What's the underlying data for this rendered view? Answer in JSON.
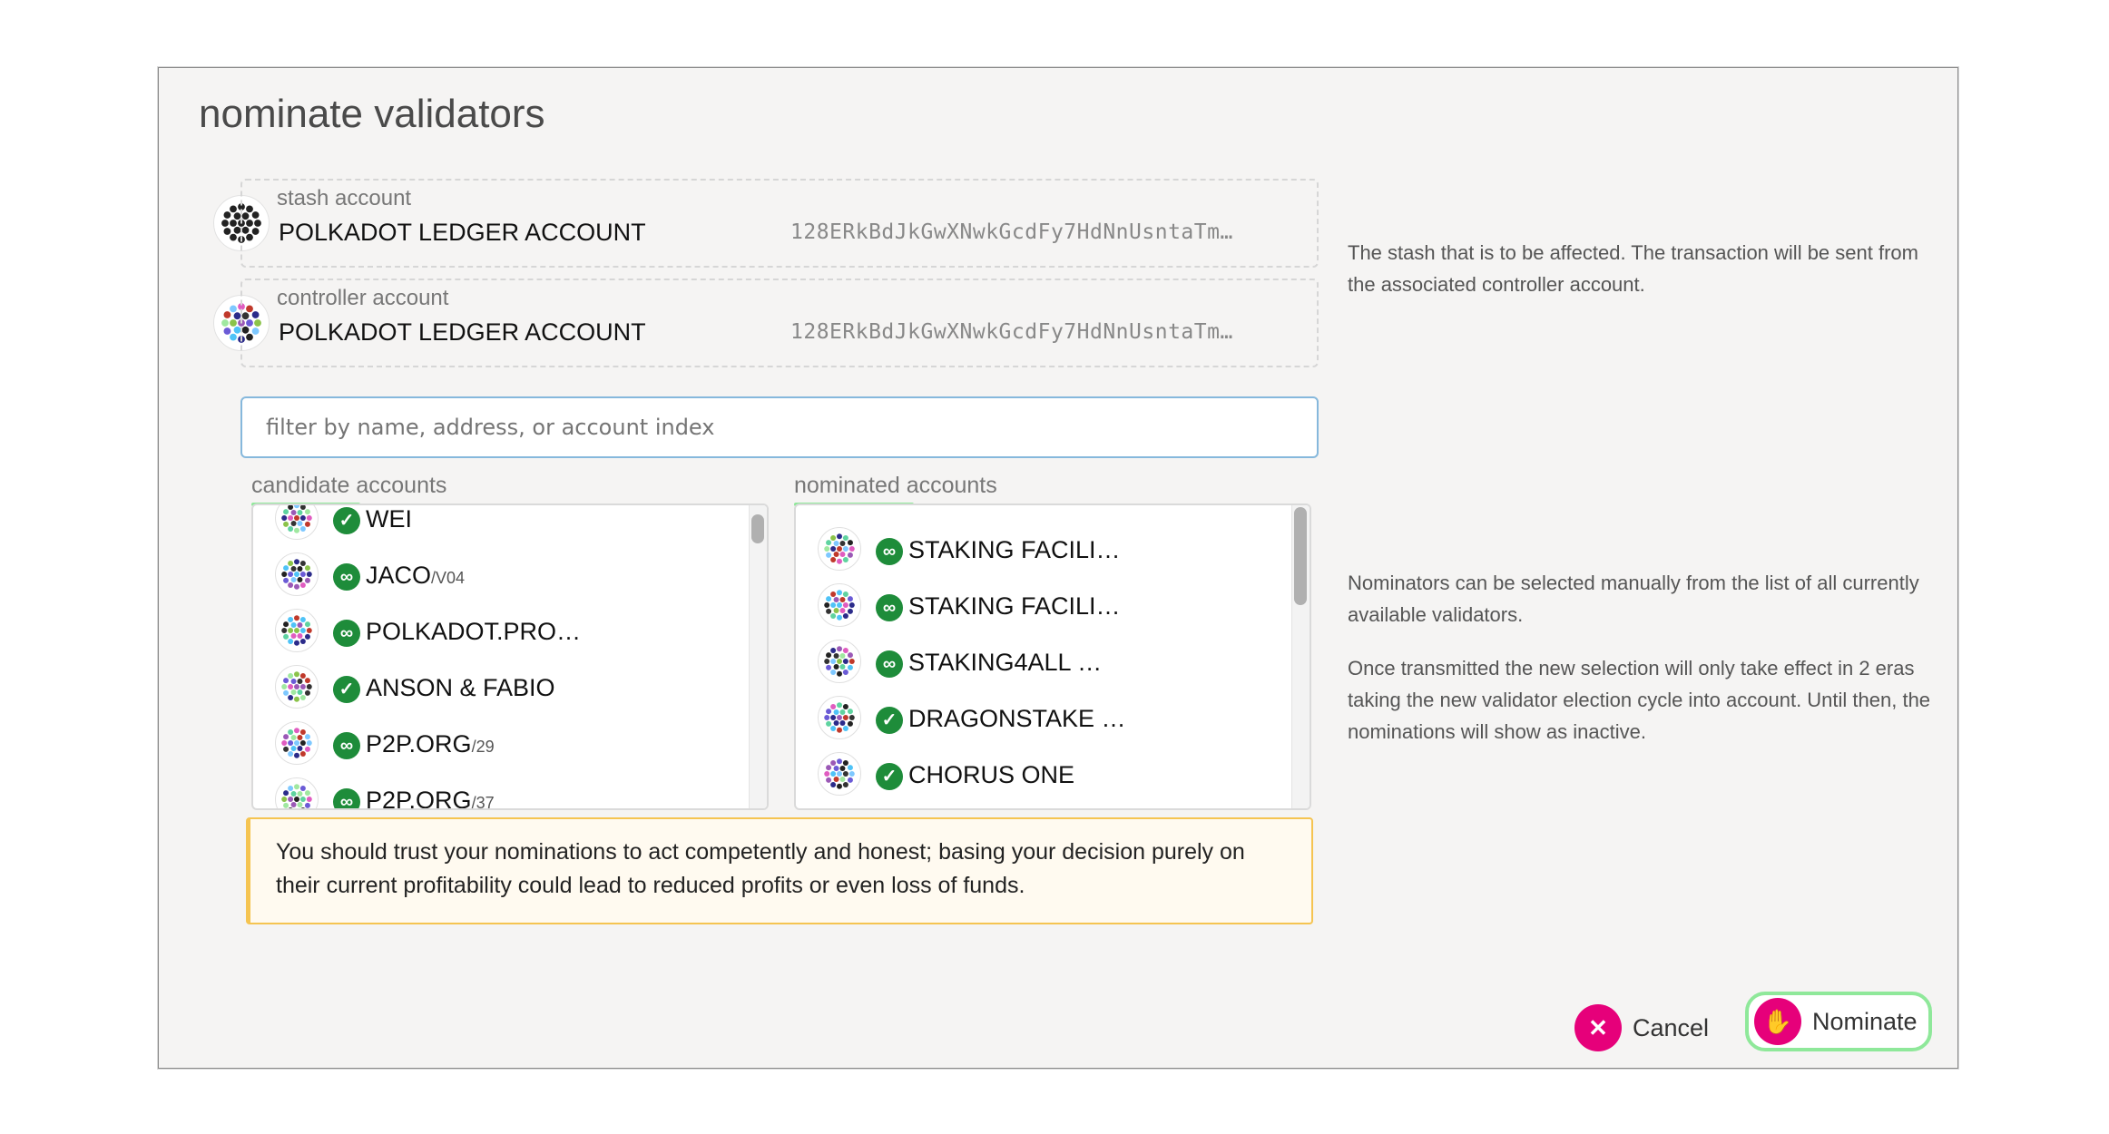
{
  "modal": {
    "title": "nominate validators"
  },
  "stash": {
    "label": "stash account",
    "name": "POLKADOT LEDGER ACCOUNT",
    "address": "128ERkBdJkGwXNwkGcdFy7HdNnUsntaTm…"
  },
  "controller": {
    "label": "controller account",
    "name": "POLKADOT LEDGER ACCOUNT",
    "address": "128ERkBdJkGwXNwkGcdFy7HdNnUsntaTm…"
  },
  "help": {
    "accounts": "The stash that is to be affected. The transaction will be sent from the associated controller account.",
    "nominators_1": "Nominators can be selected manually from the list of all currently available validators.",
    "nominators_2": "Once transmitted the new selection will only take effect in 2 eras taking the new validator election cycle into account. Until then, the nominations will show as inactive."
  },
  "filter": {
    "placeholder": "filter by name, address, or account index"
  },
  "candidates": {
    "title": "candidate accounts",
    "items": [
      {
        "name": "WEI",
        "sub": "",
        "badge": "check"
      },
      {
        "name": "JACO",
        "sub": "/V04",
        "badge": "link"
      },
      {
        "name": "POLKADOT.PRO…",
        "sub": "",
        "badge": "link"
      },
      {
        "name": "ANSON & FABIO",
        "sub": "",
        "badge": "check"
      },
      {
        "name": "P2P.ORG",
        "sub": "/29",
        "badge": "link"
      },
      {
        "name": "P2P.ORG",
        "sub": "/37",
        "badge": "link"
      }
    ]
  },
  "nominated": {
    "title": "nominated accounts",
    "items": [
      {
        "name": "STAKING FACILI…",
        "badge": "link"
      },
      {
        "name": "STAKING FACILI…",
        "badge": "link"
      },
      {
        "name": "STAKING4ALL …",
        "badge": "link"
      },
      {
        "name": "DRAGONSTAKE …",
        "badge": "check"
      },
      {
        "name": "CHORUS ONE",
        "badge": "check"
      }
    ]
  },
  "warning": "You should trust your nominations to act competently and honest; basing your decision purely on their current profitability could lead to reduced profits or even loss of funds.",
  "actions": {
    "cancel": "Cancel",
    "nominate": "Nominate"
  },
  "colors": {
    "accent": "#e6007a",
    "verified": "#1e8c3a",
    "highlight": "#8fe89a",
    "warning_border": "#f5c451"
  }
}
